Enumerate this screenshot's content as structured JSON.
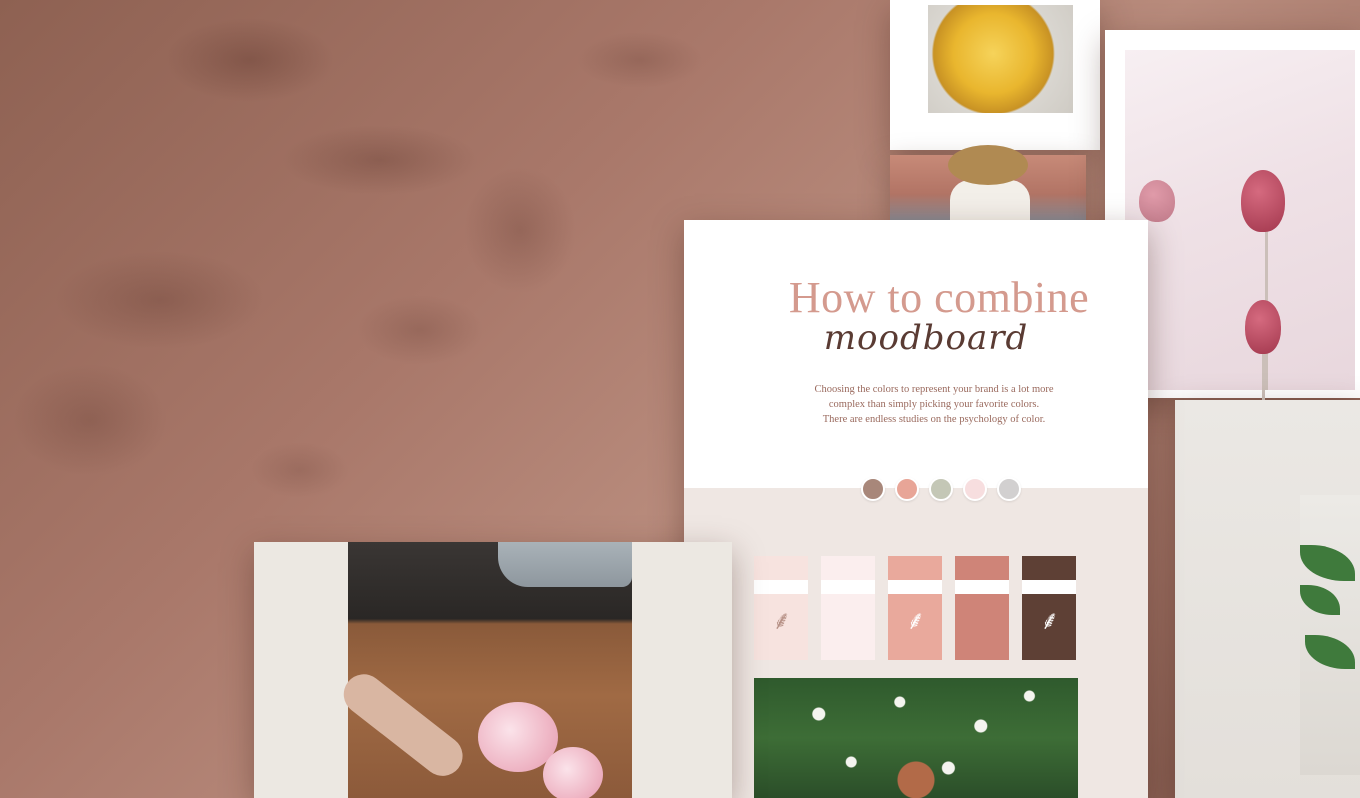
{
  "moodboard": {
    "title_line1": "How to combine",
    "title_line2": "moodboard",
    "description_line1": "Choosing the colors to represent your brand is a lot more",
    "description_line2": "complex than simply picking your favorite colors.",
    "description_line3": "There are endless studies on the psychology of color."
  },
  "palette": {
    "dots": [
      "#a8877a",
      "#e8a597",
      "#c4c7b6",
      "#f7dedf",
      "#d2d0d0"
    ],
    "swatches": [
      {
        "color": "#f7e3df",
        "sprig": true,
        "sprig_color": "#b58f84"
      },
      {
        "color": "#fbeeee",
        "sprig": false,
        "sprig_color": "#ffffff"
      },
      {
        "color": "#e9a99c",
        "sprig": true,
        "sprig_color": "#ffffff"
      },
      {
        "color": "#cf8478",
        "sprig": false,
        "sprig_color": "#ffffff"
      },
      {
        "color": "#5e4035",
        "sprig": true,
        "sprig_color": "#ffffff"
      }
    ]
  },
  "sprig_glyph": "⸙"
}
